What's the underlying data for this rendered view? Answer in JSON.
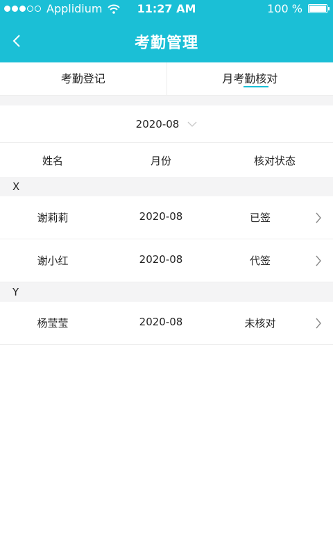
{
  "status_bar": {
    "carrier": "Applidium",
    "time": "11:27 AM",
    "battery": "100 %",
    "signal_icon": "signal-dots-icon",
    "wifi_icon": "wifi-icon",
    "battery_icon": "battery-icon"
  },
  "navbar": {
    "title": "考勤管理",
    "back_icon": "chevron-left-icon"
  },
  "tabs": [
    {
      "label": "考勤登记",
      "active": false
    },
    {
      "label": "月考勤核对",
      "active": true
    }
  ],
  "month_selector": {
    "value": "2020-08",
    "icon": "chevron-down-icon"
  },
  "columns": {
    "name": "姓名",
    "month": "月份",
    "status": "核对状态"
  },
  "sections": [
    {
      "letter": "X",
      "rows": [
        {
          "name": "谢莉莉",
          "month": "2020-08",
          "status": "已签"
        },
        {
          "name": "谢小红",
          "month": "2020-08",
          "status": "代签"
        }
      ]
    },
    {
      "letter": "Y",
      "rows": [
        {
          "name": "杨莹莹",
          "month": "2020-08",
          "status": "未核对"
        }
      ]
    }
  ],
  "colors": {
    "accent": "#1bbfd6",
    "section_bg": "#f4f4f5"
  }
}
